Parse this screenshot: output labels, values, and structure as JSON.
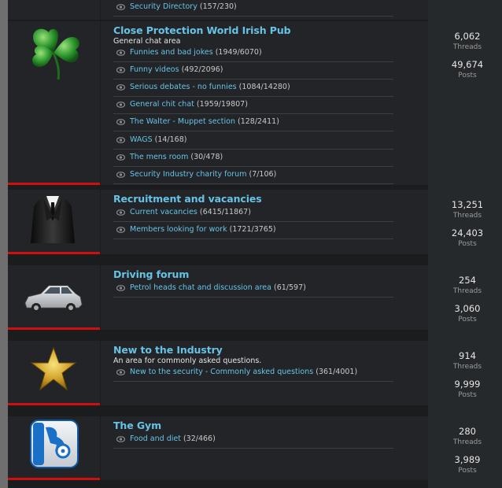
{
  "top_link": {
    "label": "Security Directory",
    "count": "(157/230)"
  },
  "forums": [
    {
      "title": "Close Protection World Irish Pub",
      "description": "General chat area",
      "icon": "shamrock-icon",
      "threads": "6,062",
      "threads_label": "Threads",
      "posts": "49,674",
      "posts_label": "Posts",
      "subforums": [
        {
          "label": "Funnies and bad jokes",
          "count": "(1949/6070)"
        },
        {
          "label": "Funny videos",
          "count": "(492/2096)"
        },
        {
          "label": "Serious debates - no funnies",
          "count": "(1084/14280)"
        },
        {
          "label": "General chit chat",
          "count": "(1959/19807)"
        },
        {
          "label": "The Walter - Muppet section",
          "count": "(128/2411)"
        },
        {
          "label": "WAGS",
          "count": "(14/168)"
        },
        {
          "label": "The mens room",
          "count": "(30/478)"
        },
        {
          "label": "Security Industry charity forum",
          "count": "(7/106)"
        }
      ]
    },
    {
      "title": "Recruitment and vacancies",
      "description": "",
      "icon": "suit-icon",
      "threads": "13,251",
      "threads_label": "Threads",
      "posts": "24,403",
      "posts_label": "Posts",
      "subforums": [
        {
          "label": "Current vacancies",
          "count": "(6415/11867)"
        },
        {
          "label": "Members looking for work",
          "count": "(1721/3765)"
        }
      ]
    },
    {
      "title": "Driving forum",
      "description": "",
      "icon": "car-icon",
      "threads": "254",
      "threads_label": "Threads",
      "posts": "3,060",
      "posts_label": "Posts",
      "subforums": [
        {
          "label": "Petrol heads chat and discussion area",
          "count": "(61/597)"
        }
      ]
    },
    {
      "title": "New to the Industry",
      "description": "An area for commonly asked questions.",
      "icon": "star-icon",
      "threads": "914",
      "threads_label": "Threads",
      "posts": "9,999",
      "posts_label": "Posts",
      "subforums": [
        {
          "label": "New to the security - Commonly asked questions",
          "count": "(361/4001)"
        }
      ]
    },
    {
      "title": "The Gym",
      "description": "",
      "icon": "gym-app-icon",
      "threads": "280",
      "threads_label": "Threads",
      "posts": "3,989",
      "posts_label": "Posts",
      "subforums": [
        {
          "label": "Food and diet",
          "count": "(32/466)"
        }
      ]
    }
  ]
}
